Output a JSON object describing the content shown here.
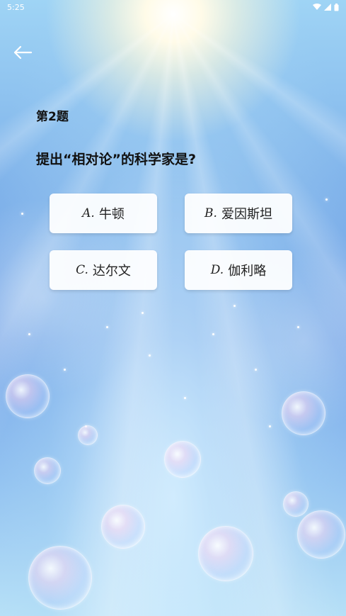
{
  "status_bar": {
    "time": "5:25",
    "icons": [
      "wifi-icon",
      "signal-icon",
      "battery-icon"
    ]
  },
  "nav": {
    "back_icon": "arrow-left-icon"
  },
  "quiz": {
    "question_number": "第2题",
    "question_text": "提出“相对论”的科学家是?",
    "options": [
      {
        "letter": "A.",
        "text": "牛顿"
      },
      {
        "letter": "B.",
        "text": "爱因斯坦"
      },
      {
        "letter": "C.",
        "text": "达尔文"
      },
      {
        "letter": "D.",
        "text": "伽利略"
      }
    ]
  }
}
